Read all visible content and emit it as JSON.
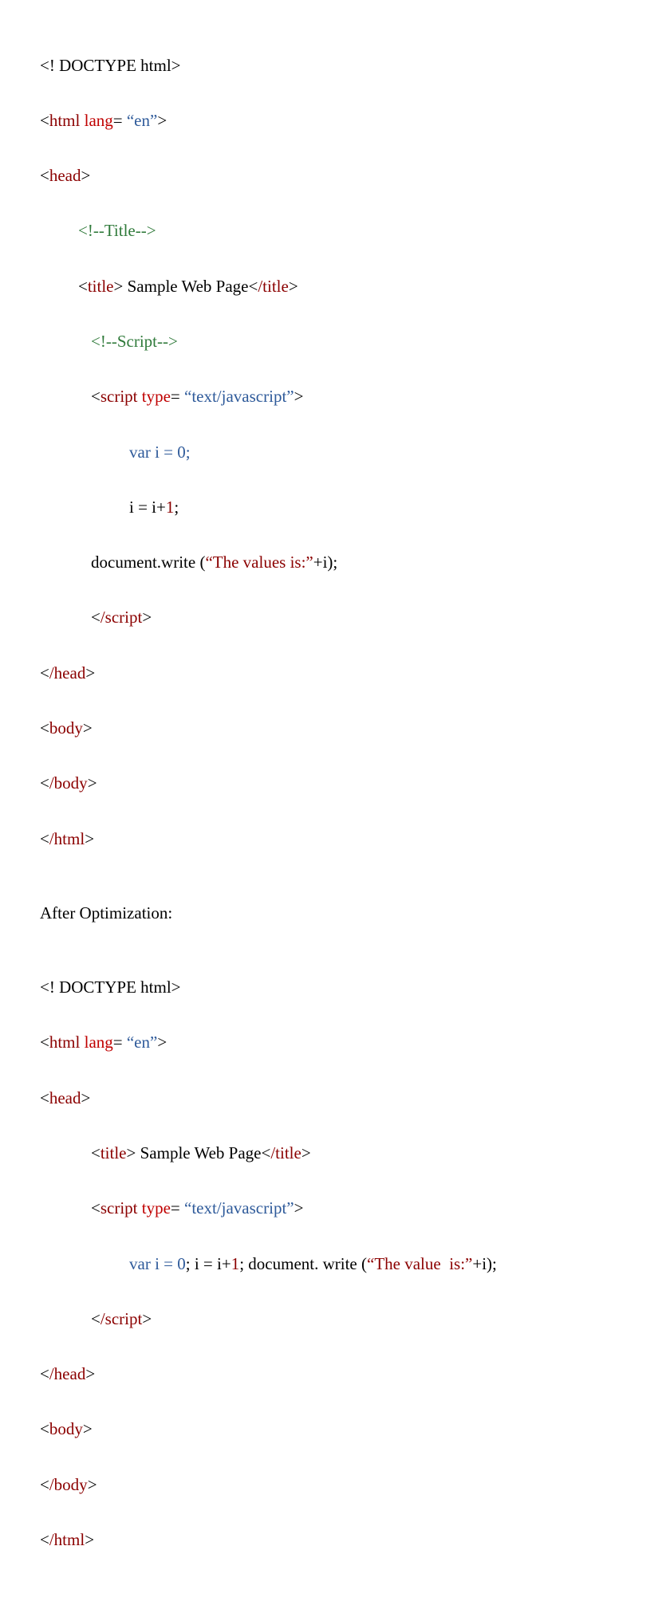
{
  "block1": {
    "l1": {
      "a": "<! DOCTYPE html>"
    },
    "l2": {
      "a": "<",
      "b": "html",
      "c": " ",
      "d": "lang",
      "e": "= ",
      "f": "“en”",
      "g": ">"
    },
    "l3": {
      "a": "<",
      "b": "head",
      "c": ">"
    },
    "l4": {
      "a": "<!--Title-->"
    },
    "l5": {
      "a": "<",
      "b": "title",
      "c": "> Sample Web Page<",
      "d": "/title",
      "e": ">"
    },
    "l6": {
      "a": "<!--Script-->"
    },
    "l7": {
      "a": "<",
      "b": "script",
      "c": " ",
      "d": "type",
      "e": "= ",
      "f": "“text/javascript”",
      "g": ">"
    },
    "l8": {
      "a": "var i = 0;"
    },
    "l9": {
      "a": "i = i+",
      "b": "1",
      "c": ";"
    },
    "l10": {
      "a": "document.write (",
      "b": "“The values is:”",
      "c": "+i);"
    },
    "l11": {
      "a": "<",
      "b": "/script",
      "c": ">"
    },
    "l12": {
      "a": "<",
      "b": "/head",
      "c": ">"
    },
    "l13": {
      "a": "<",
      "b": "body",
      "c": ">"
    },
    "l14": {
      "a": "<",
      "b": "/body",
      "c": ">"
    },
    "l15": {
      "a": "<",
      "b": "/html",
      "c": ">"
    }
  },
  "label": "After Optimization:",
  "block2": {
    "l1": {
      "a": "<! DOCTYPE html>"
    },
    "l2": {
      "a": "<",
      "b": "html",
      "c": " ",
      "d": "lang",
      "e": "= ",
      "f": "“en”",
      "g": ">"
    },
    "l3": {
      "a": "<",
      "b": "head",
      "c": ">"
    },
    "l4": {
      "a": "<",
      "b": "title",
      "c": "> Sample Web Page<",
      "d": "/title",
      "e": ">"
    },
    "l5": {
      "a": "<",
      "b": "script",
      "c": " ",
      "d": "type",
      "e": "= ",
      "f": "“text/javascript”",
      "g": ">"
    },
    "l6": {
      "a": "var i = 0",
      "b": "; i = i+",
      "c": "1",
      "d": "; document. write (",
      "e": "“The value  is:”",
      "f": "+i);"
    },
    "l7": {
      "a": "<",
      "b": "/script",
      "c": ">"
    },
    "l8": {
      "a": "<",
      "b": "/head",
      "c": ">"
    },
    "l9": {
      "a": "<",
      "b": "body",
      "c": ">"
    },
    "l10": {
      "a": "<",
      "b": "/body",
      "c": ">"
    },
    "l11": {
      "a": "<",
      "b": "/html",
      "c": ">"
    }
  }
}
